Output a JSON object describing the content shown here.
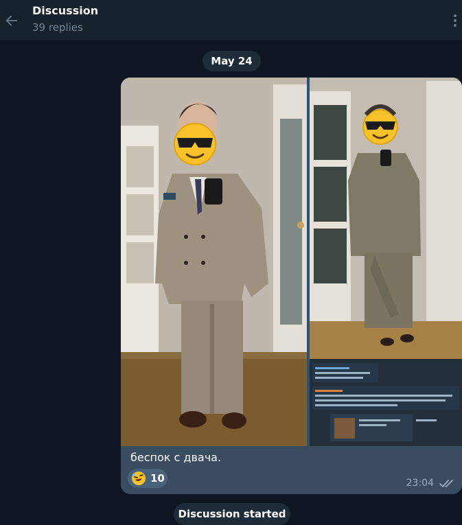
{
  "header": {
    "title": "Discussion",
    "subtitle": "39 replies",
    "back_icon": "arrow-left-icon",
    "more_icon": "more-vertical-icon"
  },
  "date_separator": "May 24",
  "message": {
    "caption": "беспок с двача.",
    "reaction": {
      "emoji_icon": "rofl-emoji-icon",
      "count": "10"
    },
    "time": "23:04",
    "status_icon": "double-check-icon",
    "photos": [
      "photo-full-suit",
      "photo-full-length-and-chat-screenshot"
    ]
  },
  "footer_badge": "Discussion started",
  "colors": {
    "background": "#0e1621",
    "header": "#17212b",
    "bubble": "#3a4d60",
    "pill": "#1e2c3a"
  }
}
